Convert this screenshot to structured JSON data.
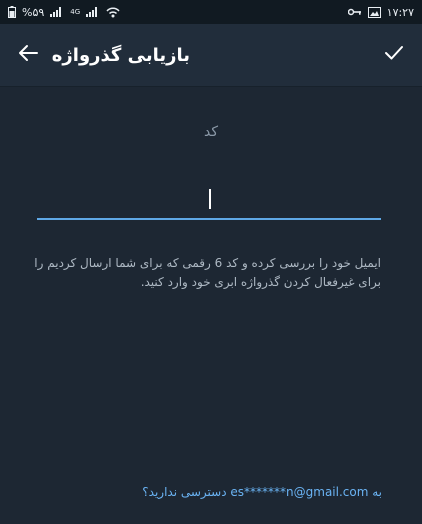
{
  "status_bar": {
    "battery": "%۵۹",
    "network_4g": "4G",
    "time": "۱۷:۲۷",
    "icons": [
      "battery-icon",
      "signal-icon",
      "signal-icon",
      "wifi-icon",
      "vpn-key-icon",
      "image-icon"
    ]
  },
  "toolbar": {
    "title": "بازیابی گذرواژه",
    "back_icon": "arrow-left-icon",
    "confirm_icon": "checkmark-icon"
  },
  "form": {
    "code_label": "کد",
    "code_value": "",
    "help_line_1": "ایمیل خود را بررسی کرده و کد 6 رقمی که برای شما ارسال کردیم را",
    "help_line_2": "برای غیرفعال کردن گذرواژه ابری خود وارد کنید.",
    "no_access_link": "به es*******n@gmail.com دسترسی ندارید؟"
  },
  "colors": {
    "background": "#1d2733",
    "toolbar": "#212d3b",
    "accent": "#5fa8e6",
    "link": "#6ab3f3"
  }
}
